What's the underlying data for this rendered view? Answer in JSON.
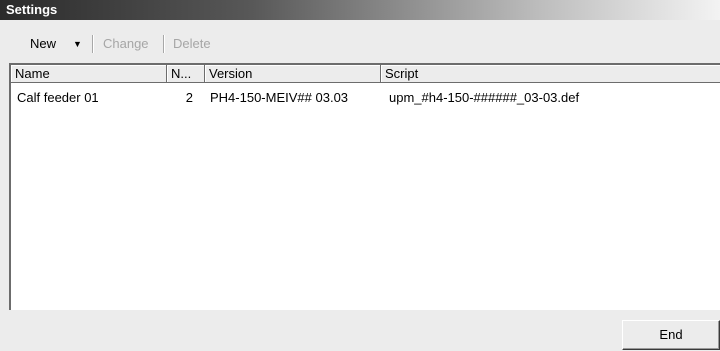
{
  "window": {
    "title": "Settings"
  },
  "toolbar": {
    "new_label": "New",
    "new_arrow": "▼",
    "change_label": "Change",
    "delete_label": "Delete"
  },
  "list": {
    "columns": [
      "Name",
      "N...",
      "Version",
      "Script"
    ],
    "rows": [
      {
        "name": "Calf feeder 01",
        "n": "2",
        "version": "PH4-150-MEIV## 03.03",
        "script": "upm_#h4-150-######_03-03.def"
      }
    ]
  },
  "footer": {
    "end_label": "End"
  }
}
